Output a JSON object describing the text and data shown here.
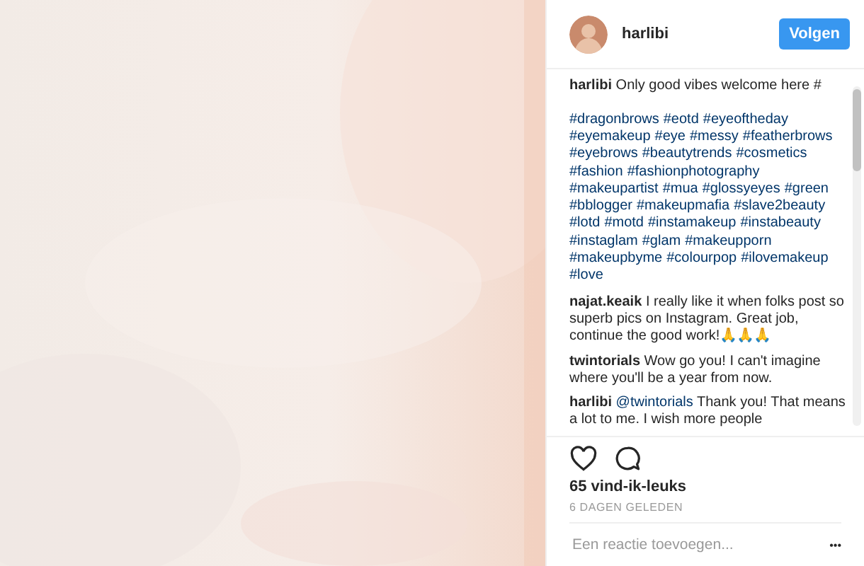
{
  "header": {
    "username": "harlibi",
    "follow_button": "Volgen"
  },
  "caption": {
    "author": "harlibi",
    "text": "Only good vibes welcome here #",
    "hashtags": [
      "#dragonbrows",
      "#eotd",
      "#eyeoftheday",
      "#eyemakeup",
      "#eye",
      "#messy",
      "#featherbrows",
      "#eyebrows",
      "#beautytrends",
      "#cosmetics",
      "#fashion",
      "#fashionphotography",
      "#makeupartist",
      "#mua",
      "#glossyeyes",
      "#green",
      "#bblogger",
      "#makeupmafia",
      "#slave2beauty",
      "#lotd",
      "#motd",
      "#instamakeup",
      "#instabeauty",
      "#instaglam",
      "#glam",
      "#makeupporn",
      "#makeupbyme",
      "#colourpop",
      "#ilovemakeup",
      "#love"
    ]
  },
  "comments": [
    {
      "author": "najat.keaik",
      "text": "I really like it when folks post so superb pics on Instagram. Great job, continue the good work!🙏🙏🙏"
    },
    {
      "author": "twintorials",
      "text": "Wow go you! I can't imagine where you'll be a year from now."
    },
    {
      "author": "harlibi",
      "mention": "@twintorials",
      "text": "Thank you! That means a lot to me. I wish more people"
    }
  ],
  "likes": "65 vind-ik-leuks",
  "date": "6 DAGEN GELEDEN",
  "comment_field": {
    "placeholder": "Een reactie toevoegen..."
  },
  "more_button": "•••"
}
